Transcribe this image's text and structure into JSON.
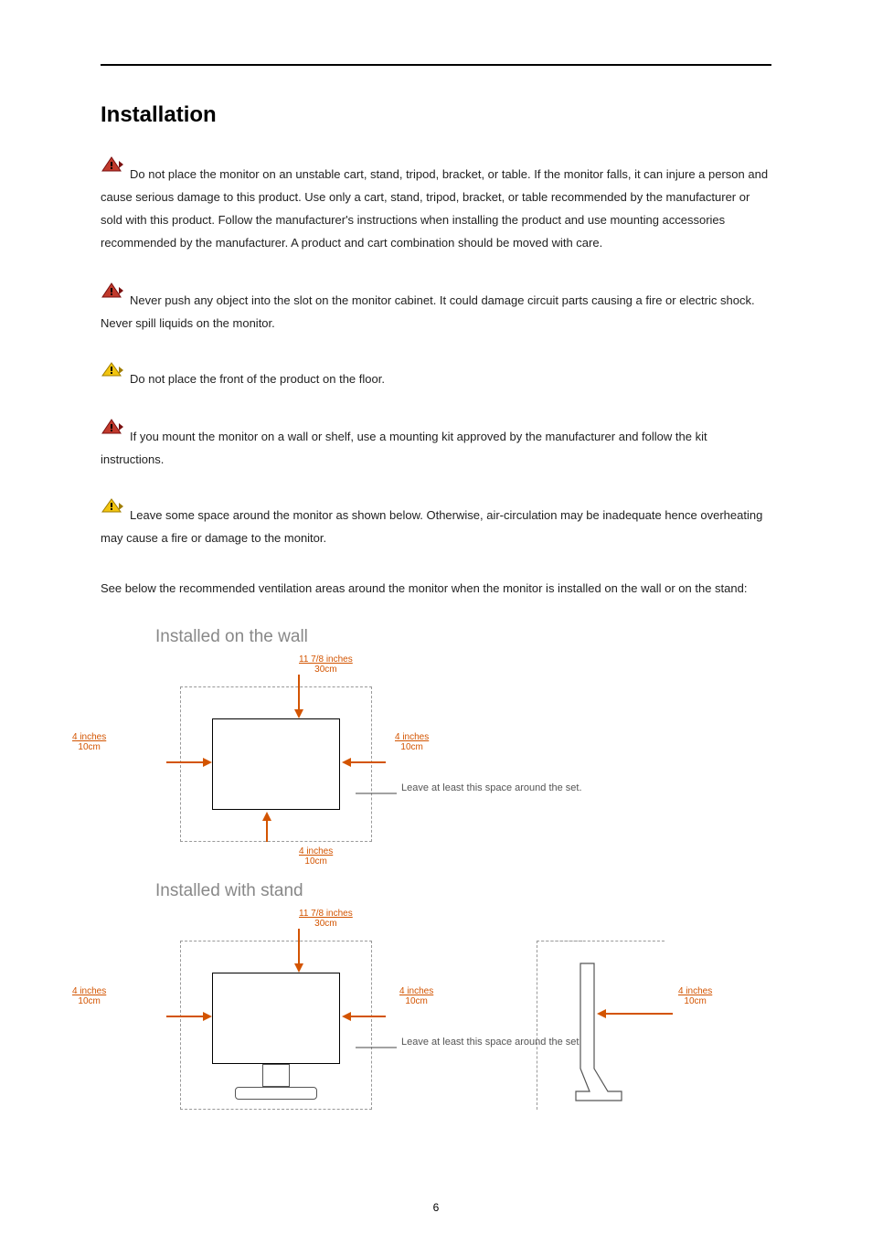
{
  "title": "Installation",
  "p1": "Do not place the monitor on an unstable cart, stand, tripod, bracket, or table. If the monitor falls, it can injure a person and cause serious damage to this product. Use only a cart, stand, tripod, bracket, or table recommended by the manufacturer or sold with this product. Follow the manufacturer's instructions when installing the product and use mounting accessories recommended by the manufacturer. A product and cart combination should be moved with care.",
  "p2": "Never push any object into the slot on the monitor cabinet. It could damage circuit parts causing a fire or electric shock. Never spill liquids on the monitor.",
  "p3": "Do not place the front of the product on the floor.",
  "p4": "If you mount the monitor on a wall or shelf, use a mounting kit approved by the manufacturer and follow the kit instructions.",
  "p5": "Leave some space around the monitor as shown below. Otherwise, air-circulation may be inadequate hence overheating may cause a fire or damage to the monitor.",
  "p6": "See below the recommended ventilation areas around the monitor when the monitor is installed on the wall or on the stand:",
  "diag1_title": "Installed on the wall",
  "diag2_title": "Installed with stand",
  "dim_top_in": "11 7/8 inches",
  "dim_top_cm": "30cm",
  "dim_side_in": "4 inches",
  "dim_side_cm": "10cm",
  "caption": "Leave at least this space around the set.",
  "page_number": "6"
}
